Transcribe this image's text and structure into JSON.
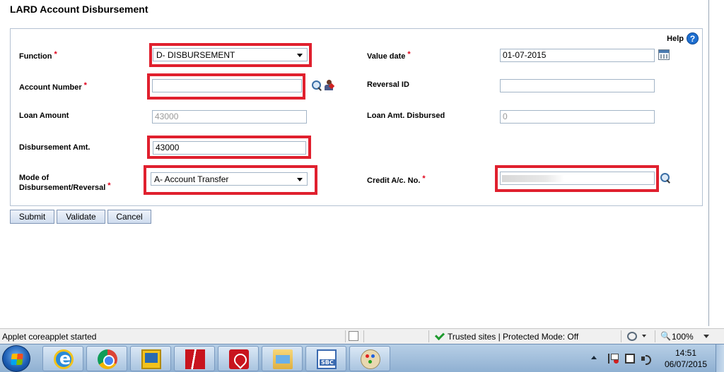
{
  "page": {
    "title": "LARD Account Disbursement"
  },
  "help": {
    "label": "Help",
    "icon": "?"
  },
  "form": {
    "function": {
      "label": "Function",
      "value": "D- DISBURSEMENT"
    },
    "value_date": {
      "label": "Value date",
      "value": "01-07-2015"
    },
    "account_number": {
      "label": "Account Number",
      "value": ""
    },
    "reversal_id": {
      "label": "Reversal ID",
      "value": ""
    },
    "loan_amount": {
      "label": "Loan Amount",
      "value": "43000"
    },
    "loan_amt_disbursed": {
      "label": "Loan Amt. Disbursed",
      "value": "0"
    },
    "disbursement_amt": {
      "label": "Disbursement Amt.",
      "value": "43000"
    },
    "mode": {
      "label_line1": "Mode of",
      "label_line2": "Disbursement/Reversal",
      "value": "A- Account Transfer"
    },
    "credit_ac_no": {
      "label": "Credit A/c. No."
    },
    "required_marker": "*"
  },
  "buttons": {
    "submit": "Submit",
    "validate": "Validate",
    "cancel": "Cancel"
  },
  "statusbar": {
    "left_text": "Applet coreapplet started",
    "zone_text": "Trusted sites | Protected Mode: Off",
    "zoom": "100%"
  },
  "taskbar": {
    "time": "14:51",
    "date": "06/07/2015"
  },
  "colors": {
    "highlight": "#e0202e",
    "required": "#e0001b",
    "help_icon": "#1e6fd0"
  }
}
